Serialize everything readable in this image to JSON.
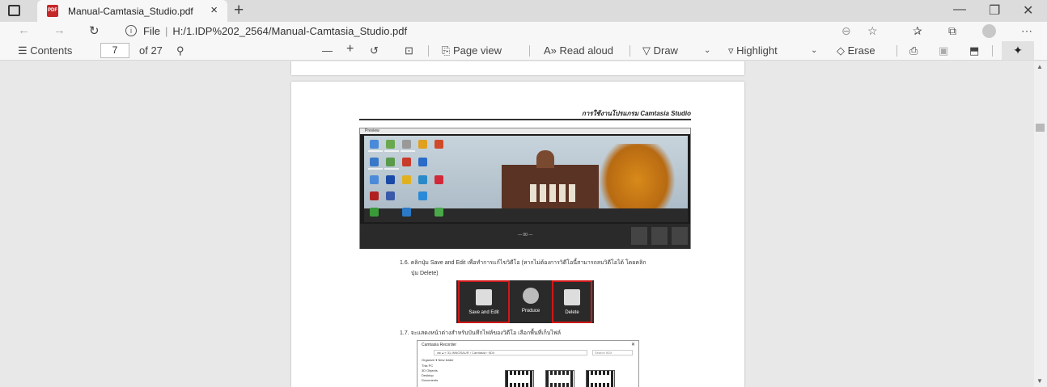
{
  "tab": {
    "title": "Manual-Camtasia_Studio.pdf",
    "close": "×",
    "new_tab": "+",
    "pdf_badge": "PDF"
  },
  "window_controls": {
    "minimize": "—",
    "maximize": "❐",
    "close": "✕"
  },
  "address": {
    "back": "←",
    "forward": "→",
    "refresh": "↻",
    "info": "i",
    "file_label": "File",
    "url": "H:/1.IDP%202_2564/Manual-Camtasia_Studio.pdf"
  },
  "pdf_toolbar": {
    "contents": "Contents",
    "page": "7",
    "of_pages": "of 27",
    "zoom_out": "—",
    "zoom_in": "+",
    "page_view": "Page view",
    "read_aloud": "Read aloud",
    "draw": "Draw",
    "highlight": "Highlight",
    "erase": "Erase"
  },
  "document": {
    "header": "การใช้งานโปรแกรม Camtasia Studio",
    "step_1_6_line1": "1.6.  คลิกปุ่ม Save and Edit เพื่อทำการแก้ไขวิดีโอ (หากไม่ต้องการวิดีโอนี้สามารถลบวิดีโอได้ โดยคลิก",
    "step_1_6_line2": "ปุ่ม Delete)",
    "step_1_7": "1.7.  จะแสดงหน้าต่างสำหรับบันทึกไฟล์ของวิดีโอ เลือกพื้นที่เก็บไฟล์",
    "buttons": {
      "save": "Save and Edit",
      "produce": "Produce",
      "delete": "Delete"
    },
    "recorder_title": "Preview",
    "recorder_time": "— 00 —",
    "dialog": {
      "title": "Camtasia Recorder",
      "path": "◂ ▸ ▴ « 31-INNOSAUR › Camtasia › 9DX",
      "search": "Search 9DX",
      "organize": "Organize ▾     New folder",
      "sidebar": [
        "This PC",
        "3D Objects",
        "Desktop",
        "Documents"
      ]
    }
  },
  "colors": {
    "accent_red": "#d01818",
    "pdf_red": "#c52828"
  }
}
